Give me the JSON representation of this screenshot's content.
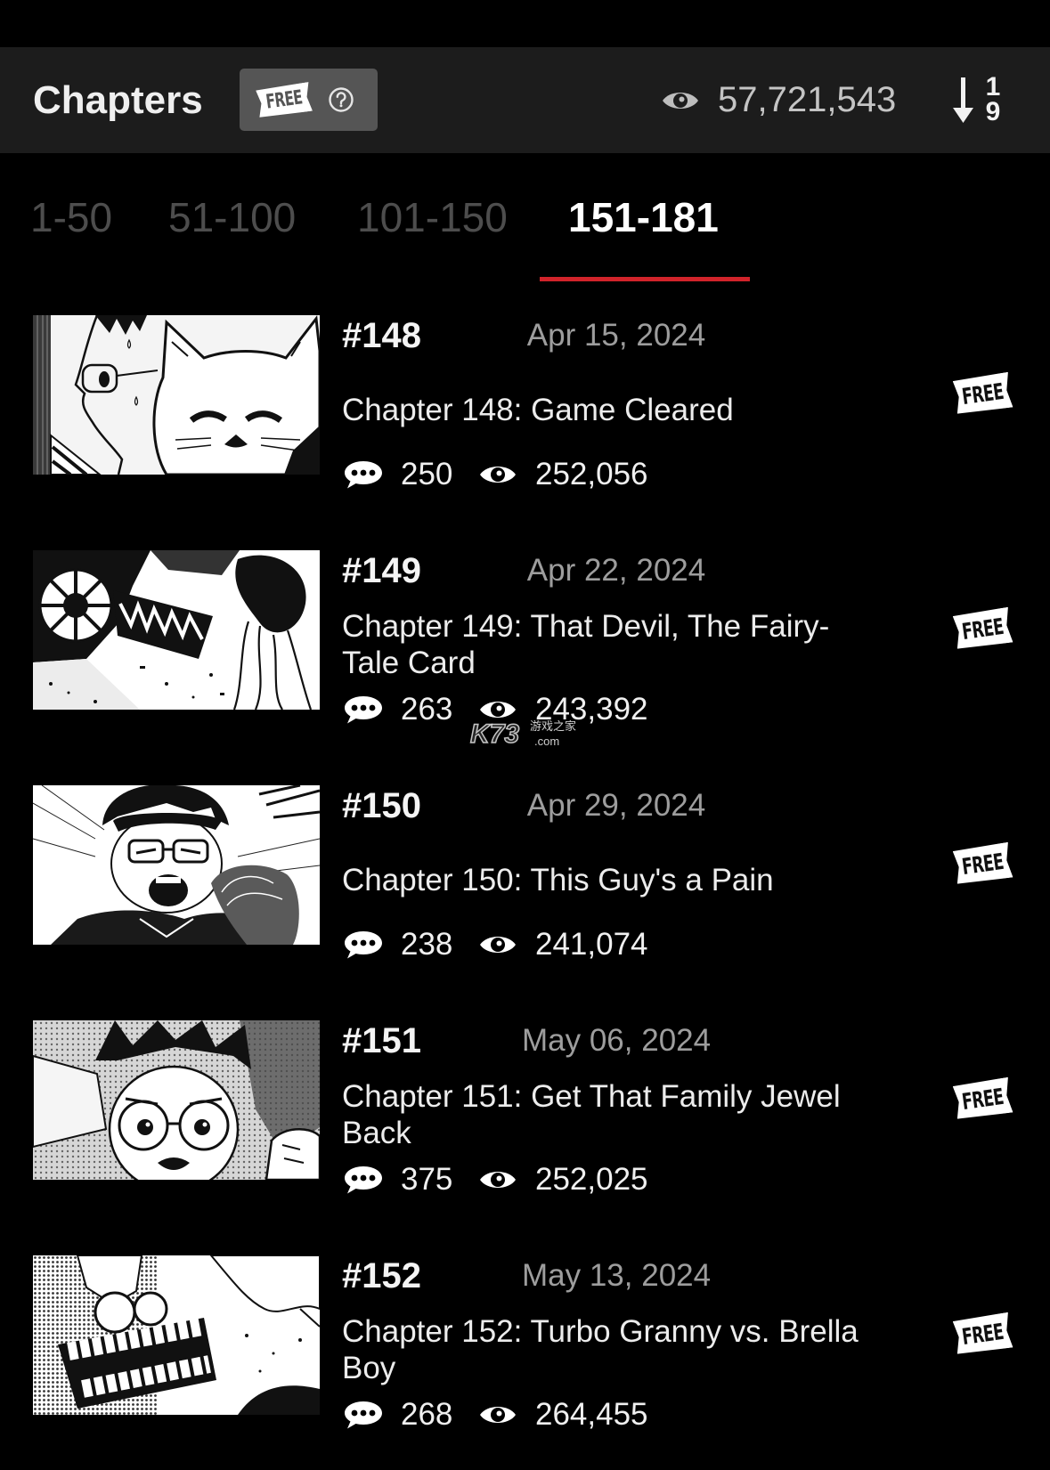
{
  "header": {
    "title": "Chapters",
    "free_badge": "FREE",
    "total_views": "57,721,543",
    "sort": {
      "top": "1",
      "bottom": "9"
    }
  },
  "tabs": [
    {
      "label": "1-50",
      "active": false
    },
    {
      "label": "51-100",
      "active": false
    },
    {
      "label": "101-150",
      "active": false
    },
    {
      "label": "151-181",
      "active": true
    }
  ],
  "chapters": [
    {
      "number": "#148",
      "date": "Apr 15, 2024",
      "title": "Chapter 148: Game Cleared",
      "comments": "250",
      "views": "252,056",
      "badge": "FREE"
    },
    {
      "number": "#149",
      "date": "Apr 22, 2024",
      "title": "Chapter 149: That Devil, The Fairy-Tale Card",
      "comments": "263",
      "views": "243,392",
      "badge": "FREE"
    },
    {
      "number": "#150",
      "date": "Apr 29, 2024",
      "title": "Chapter 150: This Guy's a Pain",
      "comments": "238",
      "views": "241,074",
      "badge": "FREE"
    },
    {
      "number": "#151",
      "date": "May 06, 2024",
      "title": "Chapter 151: Get That Family Jewel Back",
      "comments": "375",
      "views": "252,025",
      "badge": "FREE"
    },
    {
      "number": "#152",
      "date": "May 13, 2024",
      "title": "Chapter 152: Turbo Granny vs. Brella Boy",
      "comments": "268",
      "views": "264,455",
      "badge": "FREE"
    }
  ],
  "watermark": {
    "brand": "K73",
    "tagline": "游戏之家",
    "domain": ".com"
  },
  "icons": {
    "views": "eye-icon",
    "comments": "comment-bubble-icon",
    "help": "question-circle-icon",
    "sort": "sort-descending-icon"
  },
  "colors": {
    "page_background": "#000000",
    "header_background": "#1c1c1c",
    "free_box_background": "#555555",
    "active_tab": "#ffffff",
    "inactive_tab": "#4d4d4d",
    "active_tab_underline": "#d1232a",
    "date_text": "#9d9d9d"
  }
}
